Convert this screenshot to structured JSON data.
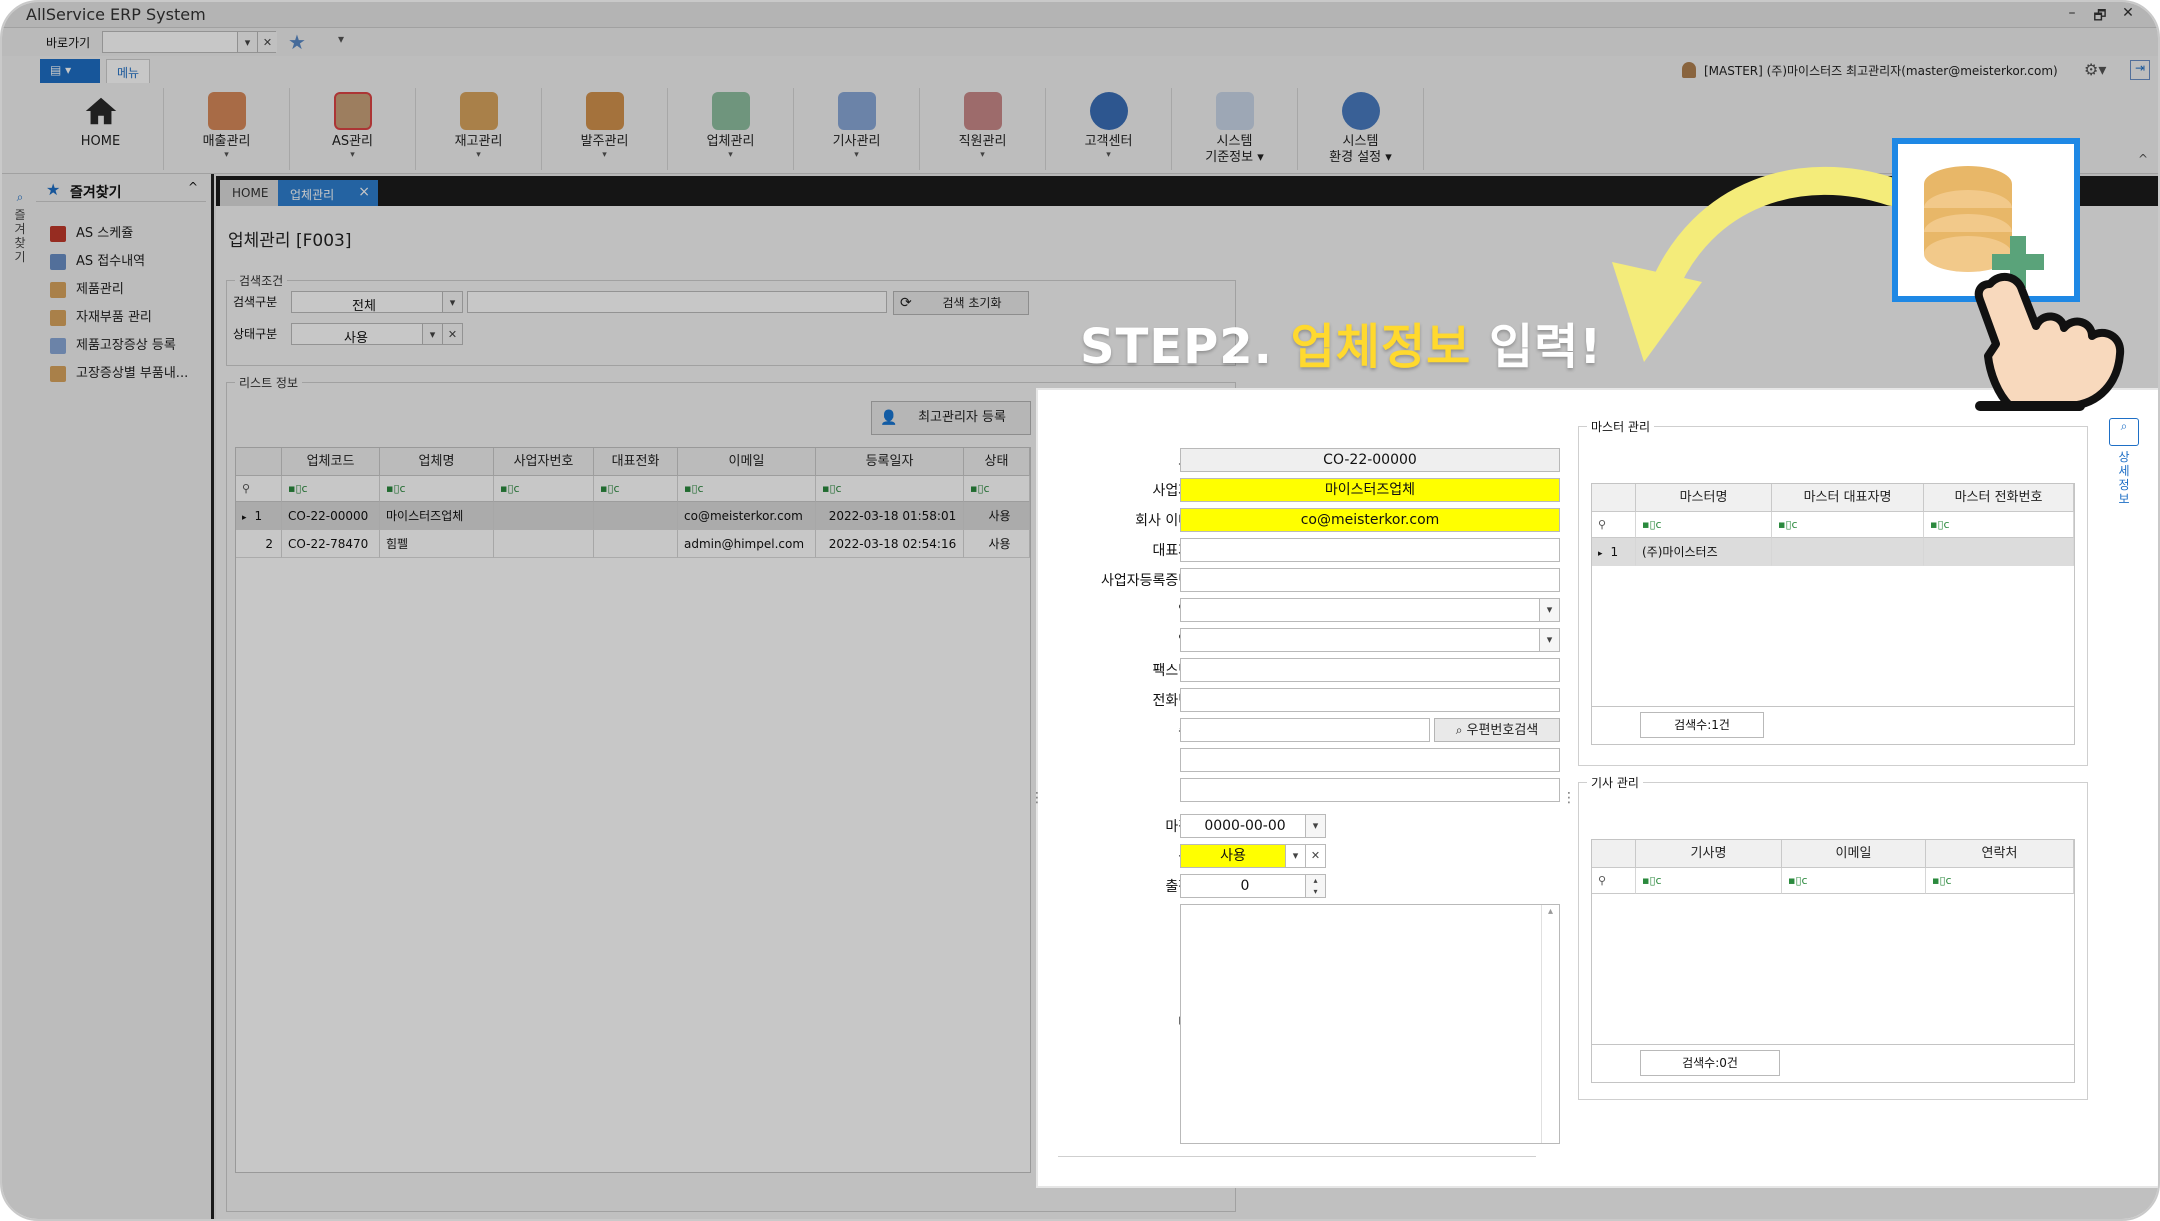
{
  "window": {
    "title": "AllService ERP System",
    "minimize": "–",
    "restore": "🗗",
    "close": "✕"
  },
  "quickbar": {
    "label": "바로가기",
    "star": "★",
    "pin": "▾"
  },
  "ribbon": {
    "tabs": [
      {
        "label": "▤ ▾"
      },
      {
        "label": "메뉴"
      }
    ],
    "user": "[MASTER] (주)마이스터즈 최고관리자(master@meisterkor.com)",
    "buttons": [
      {
        "label": "HOME",
        "dd": ""
      },
      {
        "label": "매출관리",
        "dd": "▾"
      },
      {
        "label": "AS관리",
        "dd": "▾"
      },
      {
        "label": "재고관리",
        "dd": "▾"
      },
      {
        "label": "발주관리",
        "dd": "▾"
      },
      {
        "label": "업체관리",
        "dd": "▾"
      },
      {
        "label": "기사관리",
        "dd": "▾"
      },
      {
        "label": "직원관리",
        "dd": "▾"
      },
      {
        "label": "고객센터",
        "dd": "▾"
      },
      {
        "label": "시스템\n기준정보 ▾",
        "dd": ""
      },
      {
        "label": "시스템\n환경 설정 ▾",
        "dd": ""
      }
    ]
  },
  "sidebar": {
    "vertical_label": "즐겨찾기",
    "title": "즐겨찾기",
    "collapse": "^",
    "items": [
      {
        "label": "AS 스케쥴"
      },
      {
        "label": "AS 접수내역"
      },
      {
        "label": "제품관리"
      },
      {
        "label": "자재부품 관리"
      },
      {
        "label": "제품고장증상 등록"
      },
      {
        "label": "고장증상별 부품내..."
      }
    ]
  },
  "doctabs": [
    {
      "label": "HOME"
    },
    {
      "label": "업체관리"
    },
    {
      "label": "×"
    }
  ],
  "page": {
    "title": "업체관리 [F003]"
  },
  "search": {
    "group_label": "검색조건",
    "type_label": "검색구분",
    "type_value": "전체",
    "status_label": "상태구분",
    "status_value": "사용",
    "reset_button": "검색 초기화"
  },
  "list": {
    "group_label": "리스트 정보",
    "register_button": "최고관리자 등록",
    "columns": [
      "업체코드",
      "업체명",
      "사업자번호",
      "대표전화",
      "이메일",
      "등록일자",
      "상태"
    ],
    "filter": "▪▯c",
    "rows": [
      {
        "no": "1",
        "code": "CO-22-00000",
        "name": "마이스터즈업체",
        "bizno": "",
        "phone": "",
        "email": "co@meisterkor.com",
        "date": "2022-03-18 01:58:01",
        "status": "사용"
      },
      {
        "no": "2",
        "code": "CO-22-78470",
        "name": "힘펠",
        "bizno": "",
        "phone": "",
        "email": "admin@himpel.com",
        "date": "2022-03-18 02:54:16",
        "status": "사용"
      }
    ]
  },
  "detail": {
    "labels": {
      "code": "코드",
      "company": "사업자명",
      "email": "회사 이메일",
      "ceo": "대표자명",
      "bizno": "사업자등록증번호",
      "industry": "업종",
      "biztype": "업태",
      "fax": "팩스번호",
      "phone": "전화번호",
      "address": "주소",
      "deadline": "마감일",
      "status": "상태",
      "fee": "출장비",
      "memo": "메모"
    },
    "values": {
      "code": "CO-22-00000",
      "company": "마이스터즈업체",
      "email": "co@meisterkor.com",
      "deadline": "0000-00-00",
      "status": "사용",
      "fee": "0"
    },
    "zip_button": "우편번호검색"
  },
  "master": {
    "group_label": "마스터 관리",
    "columns": [
      "마스터명",
      "마스터 대표자명",
      "마스터 전화번호"
    ],
    "rows": [
      {
        "no": "1",
        "name": "(주)마이스터즈"
      }
    ],
    "count": "검색수:1건"
  },
  "tech": {
    "group_label": "기사 관리",
    "columns": [
      "기사명",
      "이메일",
      "연락처"
    ],
    "count": "검색수:0건"
  },
  "side_tab": "상세정보",
  "overlay": {
    "step": "STEP2.",
    "highlight": "업체정보",
    "rest": "입력!"
  },
  "colors": {
    "highlight_yellow": "#ffff00",
    "accent_blue": "#1e88e5",
    "step_yellow": "#ffd92e",
    "close_red": "#e53935"
  }
}
